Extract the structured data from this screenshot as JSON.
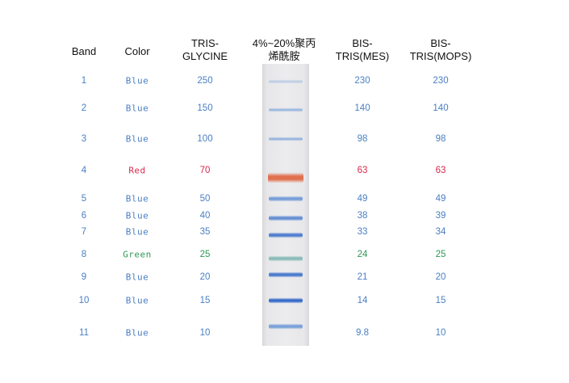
{
  "headers": {
    "band": "Band",
    "color": "Color",
    "tris_glycine": "TRIS-\nGLYCINE",
    "gel": "4%~20%聚丙\n烯酰胺",
    "bis_tris_mes": "BIS-\nTRIS(MES)",
    "bis_tris_mops": "BIS-\nTRIS(MOPS)"
  },
  "rows": [
    {
      "band": "1",
      "color": "Blue",
      "tris_glycine": "250",
      "bis_tris_mes": "230",
      "bis_tris_mops": "230",
      "swatch": "#8fb0dc",
      "intensity": 0.45
    },
    {
      "band": "2",
      "color": "Blue",
      "tris_glycine": "150",
      "bis_tris_mes": "140",
      "bis_tris_mops": "140",
      "swatch": "#6f9bd8",
      "intensity": 0.6
    },
    {
      "band": "3",
      "color": "Blue",
      "tris_glycine": "100",
      "bis_tris_mes": "98",
      "bis_tris_mops": "98",
      "swatch": "#6a97d6",
      "intensity": 0.62
    },
    {
      "band": "4",
      "color": "Red",
      "tris_glycine": "70",
      "bis_tris_mes": "63",
      "bis_tris_mops": "63",
      "swatch": "#e0704e",
      "intensity": 1
    },
    {
      "band": "5",
      "color": "Blue",
      "tris_glycine": "50",
      "bis_tris_mes": "49",
      "bis_tris_mops": "49",
      "swatch": "#5a8ad4",
      "intensity": 0.8
    },
    {
      "band": "6",
      "color": "Blue",
      "tris_glycine": "40",
      "bis_tris_mes": "38",
      "bis_tris_mops": "39",
      "swatch": "#4f80d0",
      "intensity": 0.85
    },
    {
      "band": "7",
      "color": "Blue",
      "tris_glycine": "35",
      "bis_tris_mes": "33",
      "bis_tris_mops": "34",
      "swatch": "#3f72cc",
      "intensity": 0.9
    },
    {
      "band": "8",
      "color": "Green",
      "tris_glycine": "25",
      "bis_tris_mes": "24",
      "bis_tris_mops": "25",
      "swatch": "#7ab4b0",
      "intensity": 0.85
    },
    {
      "band": "9",
      "color": "Blue",
      "tris_glycine": "20",
      "bis_tris_mes": "21",
      "bis_tris_mops": "20",
      "swatch": "#3a6fca",
      "intensity": 0.9
    },
    {
      "band": "10",
      "color": "Blue",
      "tris_glycine": "15",
      "bis_tris_mes": "14",
      "bis_tris_mops": "15",
      "swatch": "#2f66c8",
      "intensity": 0.95
    },
    {
      "band": "11",
      "color": "Blue",
      "tris_glycine": "10",
      "bis_tris_mes": "9.8",
      "bis_tris_mops": "10",
      "swatch": "#5587d2",
      "intensity": 0.75
    }
  ],
  "colors": {
    "blue": "#4a7fc3",
    "red": "#d9284a",
    "green": "#2f9a55"
  }
}
